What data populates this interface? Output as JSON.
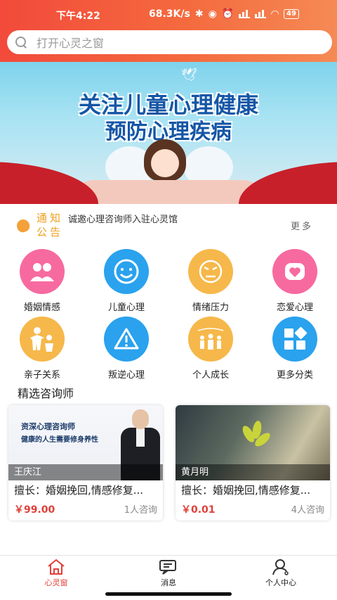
{
  "status_bar": {
    "time": "下午4:22",
    "network_speed": "68.3K/s",
    "battery": "49"
  },
  "search": {
    "placeholder": "打开心灵之窗"
  },
  "banner": {
    "line1": "关注儿童心理健康",
    "line2": "预防心理疾病"
  },
  "notice": {
    "label": "通知公告",
    "message": "诚邀心理咨询师入驻心灵馆",
    "more": "更多"
  },
  "categories": [
    {
      "label": "婚姻情感",
      "icon": "couple-icon",
      "color": "#f76aa0"
    },
    {
      "label": "儿童心理",
      "icon": "smile-face-icon",
      "color": "#2aa2ee"
    },
    {
      "label": "情绪压力",
      "icon": "stressed-face-icon",
      "color": "#f6b84a"
    },
    {
      "label": "恋爱心理",
      "icon": "heart-icon",
      "color": "#f76aa0"
    },
    {
      "label": "亲子关系",
      "icon": "parent-child-icon",
      "color": "#f6b84a"
    },
    {
      "label": "叛逆心理",
      "icon": "warning-icon",
      "color": "#2aa2ee"
    },
    {
      "label": "个人成长",
      "icon": "growth-icon",
      "color": "#f6b84a"
    },
    {
      "label": "更多分类",
      "icon": "more-categories-icon",
      "color": "#2aa2ee"
    }
  ],
  "featured": {
    "title": "精选咨询师",
    "cards": [
      {
        "name": "王庆江",
        "image_text_1": "资深心理咨询师",
        "image_text_2": "健康的人生需要修身养性",
        "specialty": "擅长：婚姻挽回,情感修复...",
        "price": "￥99.00",
        "consults": "1人咨询"
      },
      {
        "name": "黄月明",
        "specialty": "擅长：婚姻挽回,情感修复...",
        "price": "￥0.01",
        "consults": "4人咨询"
      }
    ]
  },
  "bottom_nav": [
    {
      "label": "心灵窗",
      "icon": "home-icon",
      "active": true
    },
    {
      "label": "消息",
      "icon": "message-icon",
      "active": false
    },
    {
      "label": "个人中心",
      "icon": "person-icon",
      "active": false
    }
  ],
  "colors": {
    "accent": "#e0403a",
    "header_start": "#f24a3b",
    "header_end": "#f58a55",
    "notice_label": "#f0a020"
  }
}
